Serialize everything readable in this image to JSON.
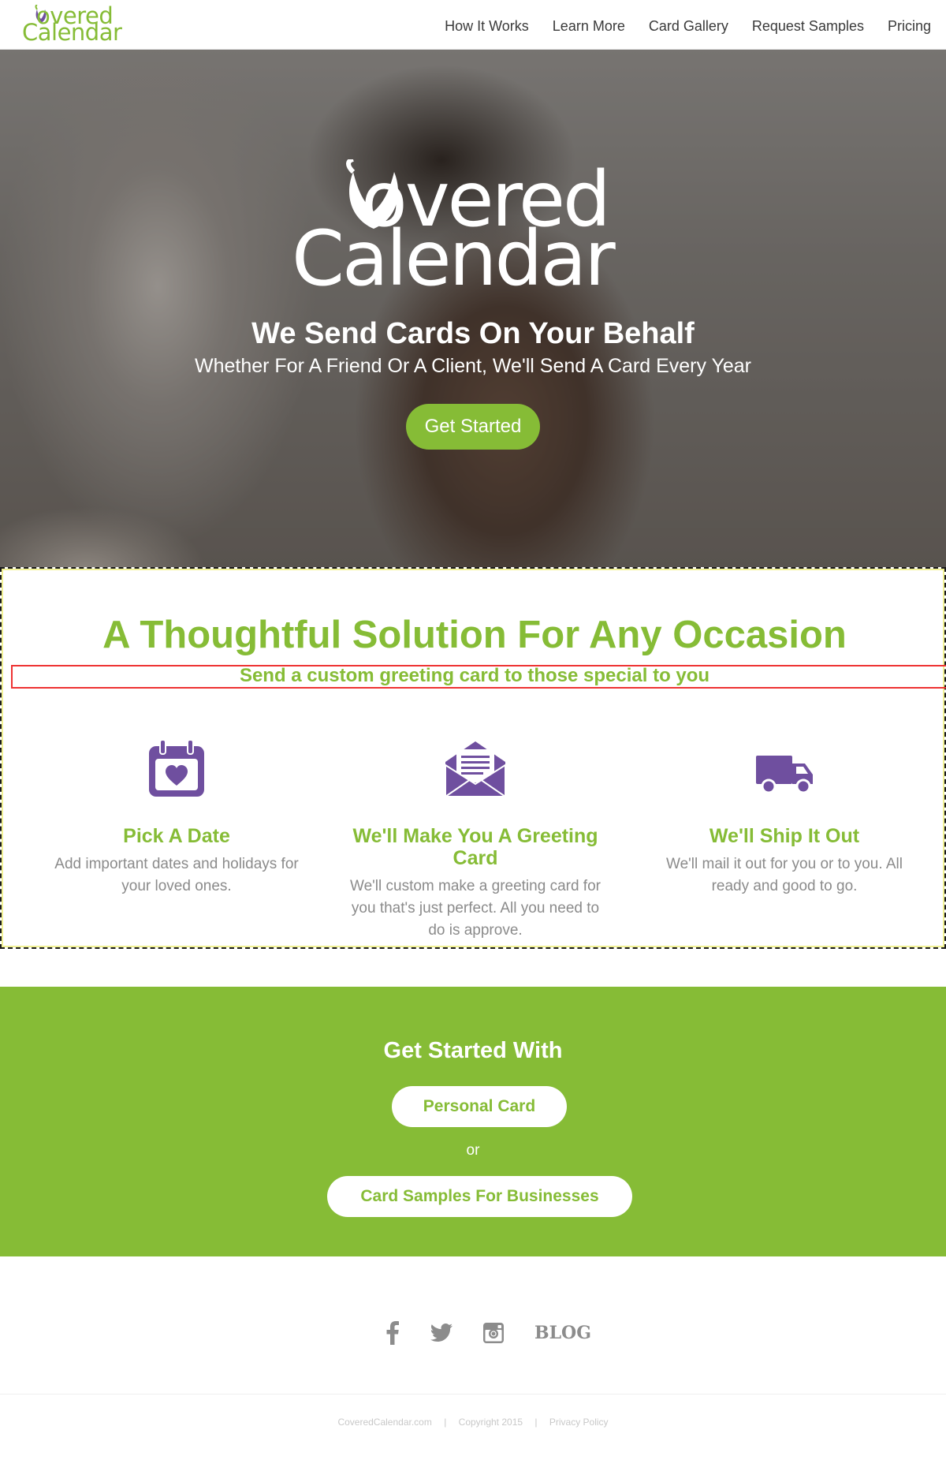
{
  "header": {
    "logo": {
      "line1": "overed",
      "line2": "Calendar",
      "initial": "C"
    },
    "nav": [
      {
        "label": "How It Works"
      },
      {
        "label": "Learn More"
      },
      {
        "label": "Card Gallery"
      },
      {
        "label": "Request Samples"
      },
      {
        "label": "Pricing"
      }
    ]
  },
  "hero": {
    "logo": {
      "line1": "overed",
      "line2": "Calendar"
    },
    "title": "We Send Cards On Your Behalf",
    "subtitle": "Whether For A Friend Or A Client, We'll Send A Card Every Year",
    "cta_label": "Get Started"
  },
  "features": {
    "title": "A Thoughtful Solution For Any Occasion",
    "subtitle": "Send a custom greeting card to those special to you",
    "items": [
      {
        "icon": "calendar-heart-icon",
        "heading": "Pick A Date",
        "text": "Add important dates and holidays for your loved ones."
      },
      {
        "icon": "envelope-letter-icon",
        "heading": "We'll Make You A Greeting Card",
        "text": "We'll custom make a greeting card for you that's just perfect. All you need to do is approve."
      },
      {
        "icon": "truck-icon",
        "heading": "We'll Ship It Out",
        "text": "We'll mail it out for you or to you. All ready and good to go."
      }
    ]
  },
  "get_started": {
    "title": "Get Started With",
    "personal_label": "Personal Card",
    "or_label": "or",
    "business_label": "Card Samples For Businesses"
  },
  "social": {
    "items": [
      {
        "icon": "facebook-icon"
      },
      {
        "icon": "twitter-icon"
      },
      {
        "icon": "instagram-icon"
      }
    ],
    "blog_label": "BLOG"
  },
  "footer": {
    "site": "CoveredCalendar.com",
    "separator": "|",
    "copyright": "Copyright 2015",
    "privacy": "Privacy Policy"
  },
  "colors": {
    "brand_green": "#86bc36",
    "brand_purple": "#6f4f9f",
    "nav_text": "#3a3a3a",
    "body_grey": "#8b8b8b"
  }
}
